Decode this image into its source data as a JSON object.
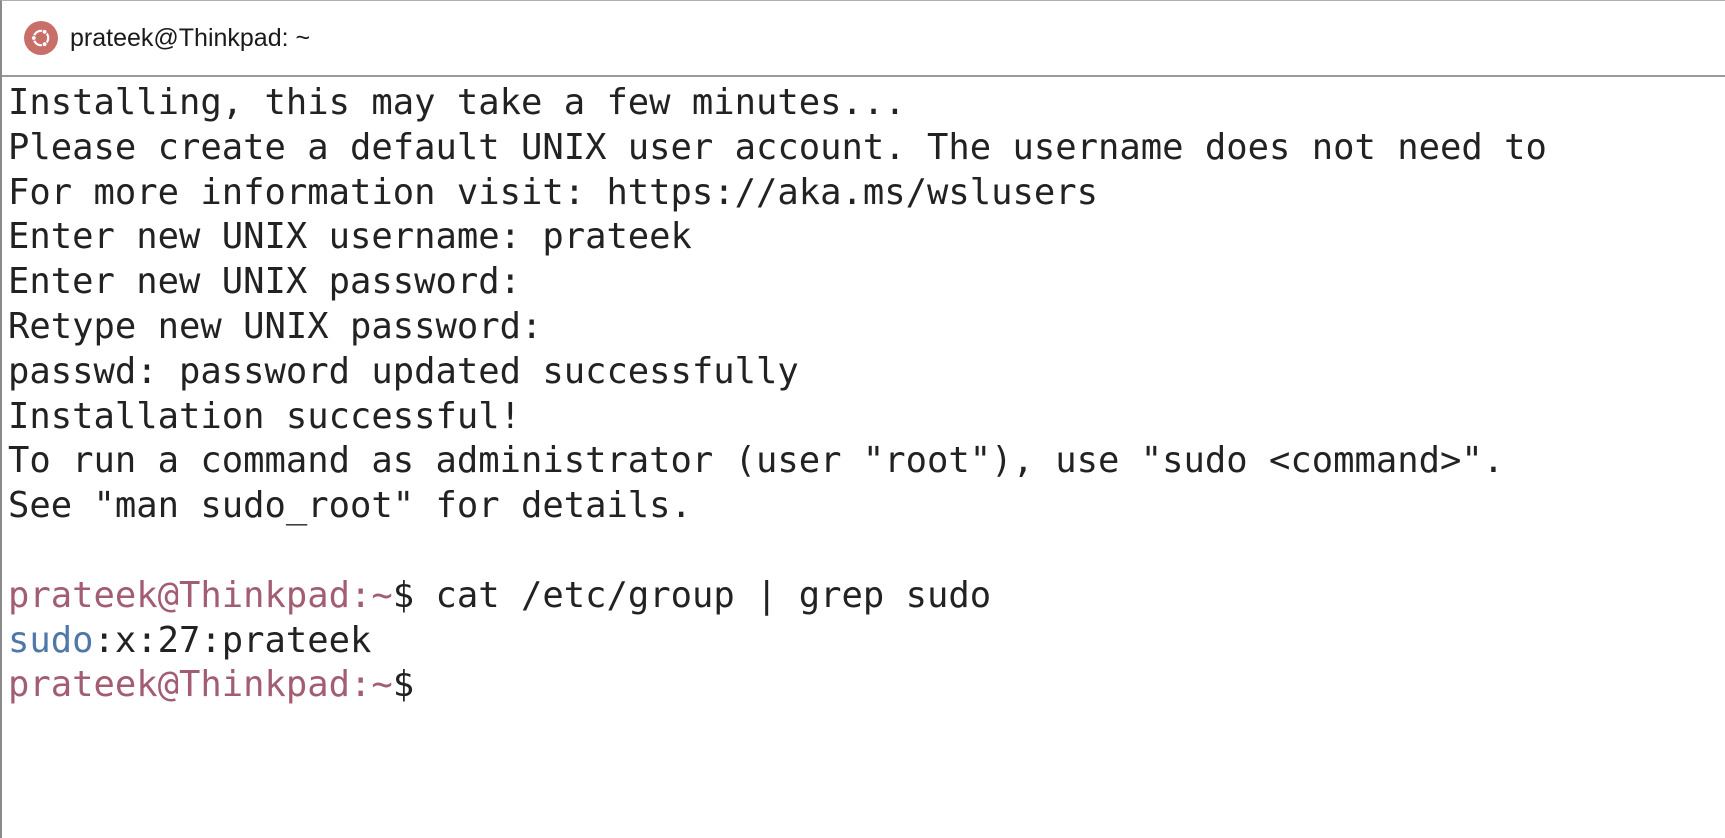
{
  "window": {
    "title": "prateek@Thinkpad: ~"
  },
  "colors": {
    "prompt": "#a35d72",
    "group_highlight": "#4f78a8",
    "text": "#222222",
    "icon": "#c96f6a"
  },
  "icons": {
    "app": "ubuntu-logo-icon"
  },
  "terminal": {
    "lines": [
      "Installing, this may take a few minutes...",
      "Please create a default UNIX user account. The username does not need to",
      "For more information visit: https://aka.ms/wslusers",
      "Enter new UNIX username: prateek",
      "Enter new UNIX password:",
      "Retype new UNIX password:",
      "passwd: password updated successfully",
      "Installation successful!",
      "To run a command as administrator (user \"root\"), use \"sudo <command>\".",
      "See \"man sudo_root\" for details."
    ],
    "command_prompt": {
      "user_host": "prateek@Thinkpad",
      "path": ":~",
      "symbol": "$",
      "command": " cat /etc/group | grep sudo"
    },
    "output": {
      "group": "sudo",
      "rest": ":x:27:prateek"
    },
    "final_prompt": {
      "user_host": "prateek@Thinkpad",
      "path": ":~",
      "symbol": "$"
    }
  }
}
